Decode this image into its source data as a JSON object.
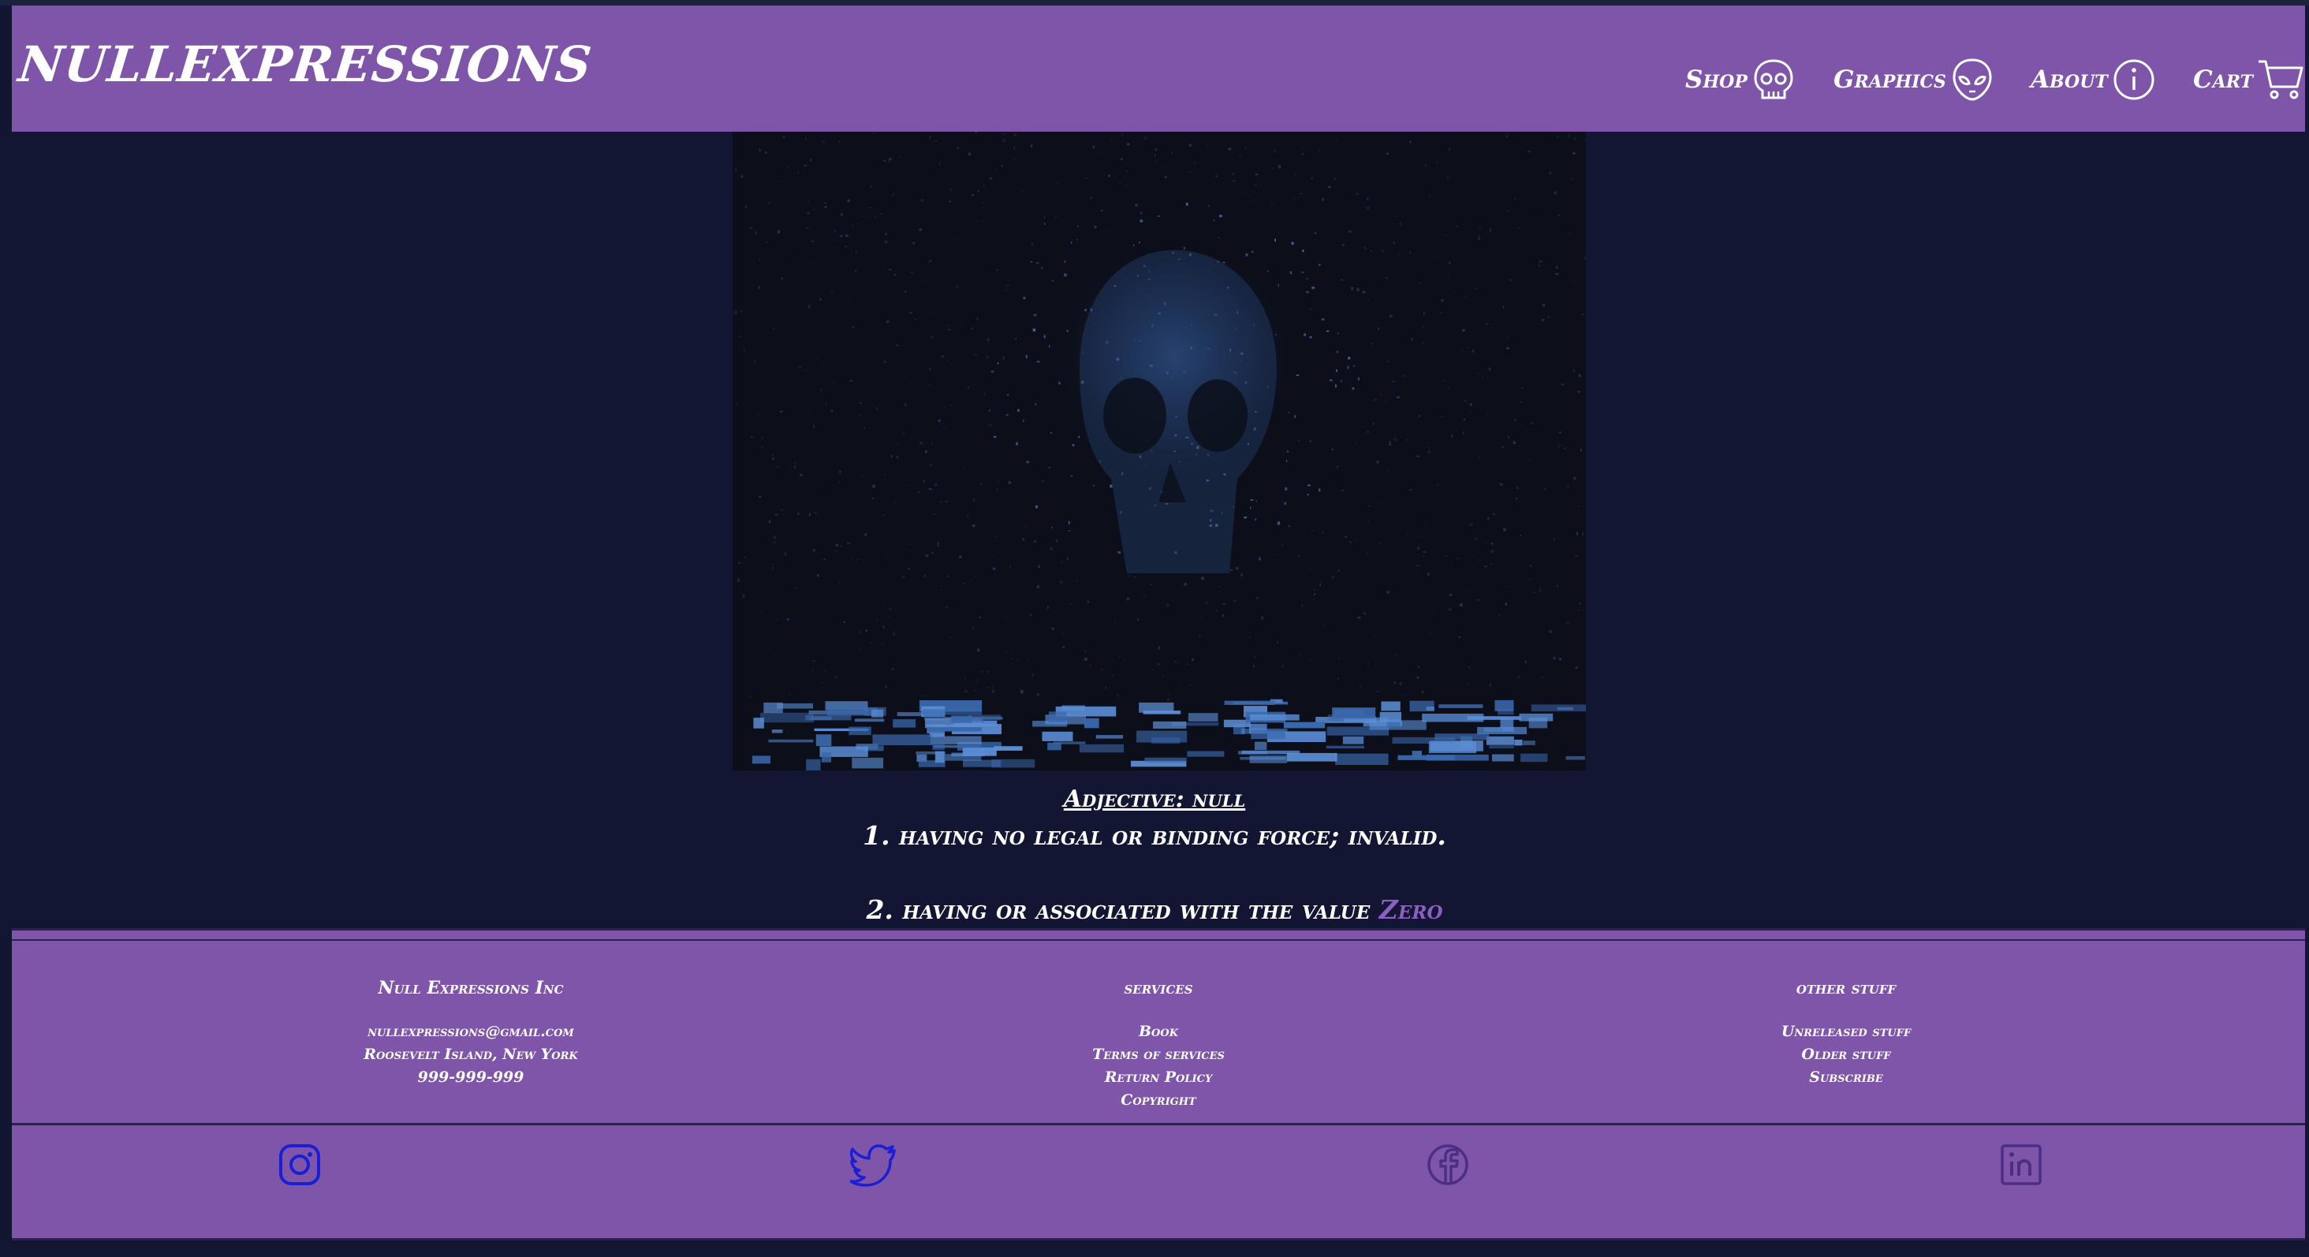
{
  "brand": {
    "title": "NULLEXPRESSIONS"
  },
  "nav": {
    "shop": {
      "label": "Shop",
      "icon": "skull-icon"
    },
    "graphics": {
      "label": "Graphics",
      "icon": "alien-icon"
    },
    "about": {
      "label": "About",
      "icon": "info-icon"
    },
    "cart": {
      "label": "Cart",
      "icon": "cart-icon"
    }
  },
  "hero": {
    "image": "glitch-skull-image"
  },
  "definition": {
    "title": "Adjective: null",
    "line1": "1. having no legal or binding force; invalid.",
    "line2_prefix": "2. having or associated with the value ",
    "line2_highlight": "Zero"
  },
  "footer": {
    "company": {
      "heading": "Null Expressions Inc",
      "email": "nullexpressions@gmail.com",
      "address": "Roosevelt Island, New York",
      "phone": "999-999-999"
    },
    "services": {
      "heading": "services",
      "items": [
        "Book",
        "Terms of services",
        "Return Policy",
        "Copyright"
      ]
    },
    "other": {
      "heading": "other stuff",
      "items": [
        "Unreleased stuff",
        "Older stuff",
        "Subscribe"
      ]
    },
    "social": {
      "instagram": "instagram-icon",
      "twitter": "twitter-icon",
      "facebook": "facebook-icon",
      "linkedin": "linkedin-icon"
    }
  },
  "colors": {
    "background": "#121633",
    "header": "#7e55a9",
    "accent": "#8c5fc0",
    "text": "#ffffff",
    "social_blue": "#1a1fd6",
    "social_dim": "#4a2f84"
  }
}
